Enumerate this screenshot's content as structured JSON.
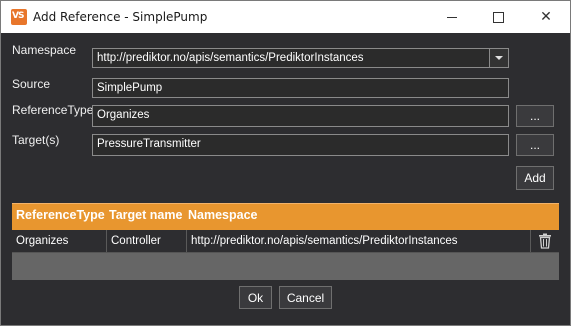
{
  "window": {
    "title": "Add Reference - SimplePump",
    "icon": "vs-app-icon",
    "close_glyph": "✕"
  },
  "form": {
    "namespace_label": "Namespace",
    "namespace_value": "http://prediktor.no/apis/semantics/PrediktorInstances",
    "source_label": "Source",
    "source_value": "SimplePump",
    "reference_type_label": "ReferenceType",
    "reference_type_value": "Organizes",
    "targets_label": "Target(s)",
    "targets_value": "PressureTransmitter",
    "browse_label": "...",
    "add_label": "Add"
  },
  "grid": {
    "headers": [
      "ReferenceType",
      "Target name",
      "Namespace"
    ],
    "rows": [
      {
        "reference_type": "Organizes",
        "target_name": "Controller",
        "namespace": "http://prediktor.no/apis/semantics/PrediktorInstances"
      }
    ]
  },
  "footer": {
    "ok_label": "Ok",
    "cancel_label": "Cancel"
  },
  "colors": {
    "accent": "#e8962f",
    "background": "#2d2d30"
  }
}
